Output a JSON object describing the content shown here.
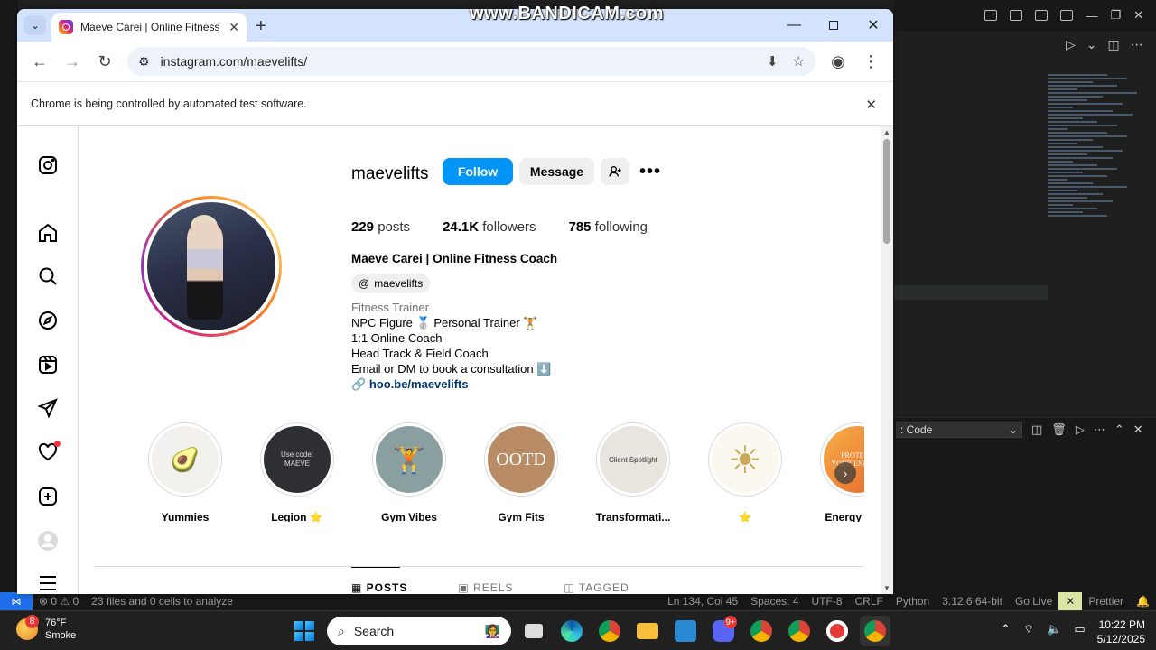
{
  "watermark": "www.BANDICAM.com",
  "browser": {
    "tab_title": "Maeve Carei | Online Fitness Co",
    "url": "instagram.com/maevelifts/",
    "infobar_text": "Chrome is being controlled by automated test software."
  },
  "profile": {
    "username": "maevelifts",
    "follow_label": "Follow",
    "message_label": "Message",
    "more_label": "•••",
    "stats": [
      {
        "value": "229",
        "label": "posts"
      },
      {
        "value": "24.1K",
        "label": "followers"
      },
      {
        "value": "785",
        "label": "following"
      }
    ],
    "full_name": "Maeve Carei | Online Fitness Coach",
    "threads_handle": "maevelifts",
    "category": "Fitness Trainer",
    "bio_lines": [
      "NPC Figure 🥈 Personal Trainer 🏋️",
      "1:1 Online Coach",
      "Head Track & Field Coach",
      "Email or DM to book a consultation ⬇️"
    ],
    "link": "hoo.be/maevelifts"
  },
  "highlights": [
    {
      "label": "Yummies",
      "bg": "#f3f1ee",
      "glyph": "🥑"
    },
    {
      "label": "Legion ⭐",
      "bg": "#2d2f33",
      "glyph": "Use code: MAEVE"
    },
    {
      "label": "Gym Vibes",
      "bg": "#8aa0a0",
      "glyph": "🏋"
    },
    {
      "label": "Gym Fits",
      "bg": "#b98c66",
      "glyph": "OOTD"
    },
    {
      "label": "Transformati...",
      "bg": "#e8e4de",
      "glyph": "Client Spotlight"
    },
    {
      "label": "⭐",
      "bg": "#fbf8f0",
      "glyph": "☀"
    },
    {
      "label": "Energy Drinl",
      "bg": "#f09030",
      "glyph": "PROTECT YOUR ENERGY"
    }
  ],
  "tabs": [
    "POSTS",
    "REELS",
    "TAGGED"
  ],
  "vscode": {
    "panel_select": ": Code",
    "status": {
      "problems": "⊗ 0 ⚠ 0",
      "analysis": "23 files and 0 cells to analyze",
      "position": "Ln 134, Col 45",
      "spaces": "Spaces: 4",
      "encoding": "UTF-8",
      "eol": "CRLF",
      "language": "Python",
      "version": "3.12.6 64-bit",
      "golive": "Go Live",
      "prettier": "Prettier"
    }
  },
  "taskbar": {
    "temp": "76°F",
    "condition": "Smoke",
    "weather_badge": "8",
    "search_label": "Search",
    "time": "10:22 PM",
    "date": "5/12/2025",
    "discord_badge": "9+"
  },
  "colors": {
    "follow_blue": "#0095f6",
    "tab_bar": "#d3e3fd"
  }
}
